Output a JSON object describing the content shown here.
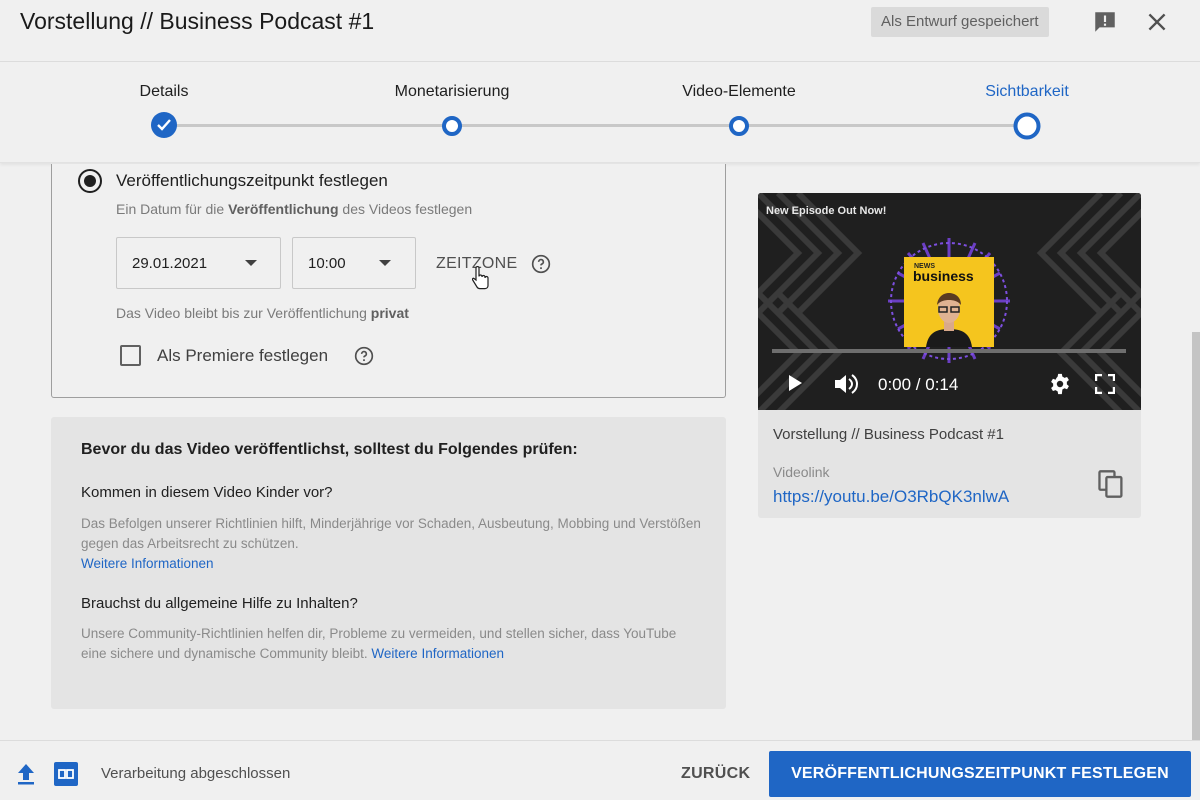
{
  "header": {
    "title": "Vorstellung // Business Podcast #1",
    "draft_status": "Als Entwurf gespeichert"
  },
  "stepper": {
    "steps": [
      {
        "label": "Details",
        "state": "done"
      },
      {
        "label": "Monetarisierung",
        "state": "open"
      },
      {
        "label": "Video-Elemente",
        "state": "open"
      },
      {
        "label": "Sichtbarkeit",
        "state": "current"
      }
    ],
    "accent_color": "#1f66c5"
  },
  "schedule": {
    "radio_label": "Veröffentlichungszeitpunkt festlegen",
    "desc_prefix": "Ein Datum für die ",
    "desc_bold": "Veröffentlichung",
    "desc_suffix": " des Videos festlegen",
    "date_value": "29.01.2021",
    "time_value": "10:00",
    "timezone_label": "ZEITZONE",
    "private_prefix": "Das Video bleibt bis zur Veröffentlichung ",
    "private_bold": "privat",
    "premiere_label": "Als Premiere festlegen"
  },
  "checklist": {
    "title": "Bevor du das Video veröffentlichst, solltest du Folgendes prüfen:",
    "q1": "Kommen in diesem Video Kinder vor?",
    "p1": "Das Befolgen unserer Richtlinien hilft, Minderjährige vor Schaden, Ausbeutung, Mobbing und Verstößen gegen das Arbeitsrecht zu schützen.",
    "p1_link": "Weitere Informationen",
    "q2": "Brauchst du allgemeine Hilfe zu Inhalten?",
    "p2": "Unsere Community-Richtlinien helfen dir, Probleme zu vermeiden, und stellen sicher, dass YouTube eine sichere und dynamische Community bleibt.",
    "p2_link": "Weitere Informationen"
  },
  "preview": {
    "overlay_title": "New Episode Out Now!",
    "thumb_small": "NEWS",
    "thumb_title": "business",
    "time": "0:00 / 0:14",
    "video_title": "Vorstellung // Business Podcast #1",
    "link_label": "Videolink",
    "link": "https://youtu.be/O3RbQK3nlwA"
  },
  "footer": {
    "status": "Verarbeitung abgeschlossen",
    "back_label": "ZURÜCK",
    "primary_label": "VERÖFFENTLICHUNGSZEITPUNKT FESTLEGEN"
  }
}
